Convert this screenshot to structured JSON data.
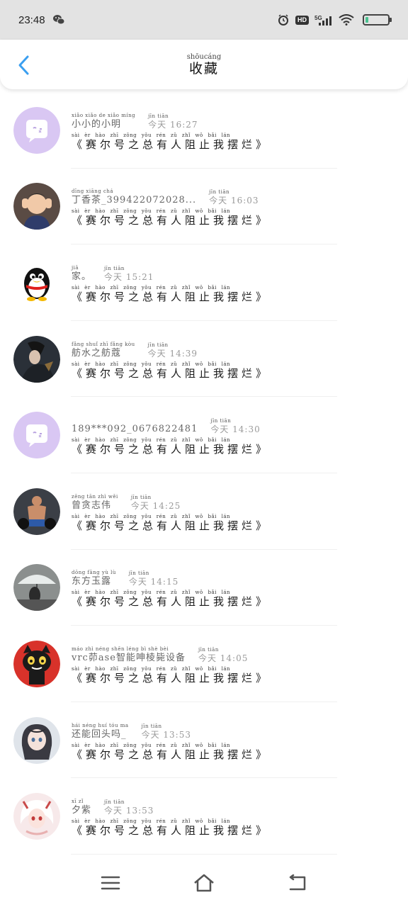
{
  "status_bar": {
    "time": "23:48",
    "app_icon": "wechat-icon",
    "icons": [
      "alarm-icon",
      "hd-badge",
      "signal-5g-icon",
      "wifi-icon",
      "battery-icon"
    ],
    "hd_label": "HD",
    "network_label": "5G"
  },
  "header": {
    "back_icon": "chevron-left-icon",
    "title_pinyin": "shōucáng",
    "title": "收藏",
    "accent_color": "#3a9ff0"
  },
  "items": [
    {
      "name_pinyin": "xiǎo xiǎo  de  xiǎo míng",
      "name": "小小的小明",
      "time_pinyin": "jīn tiān",
      "time": "今天 16:27",
      "title_pinyin": "sài  èr  hào  zhī zǒng yǒu rén  zǔ  zhǐ  wǒ  bǎi  lán",
      "title": "《赛尔号之总有人阻止我摆烂》",
      "avatar": "default-chat-avatar"
    },
    {
      "name_pinyin": "dīng xiāng chá",
      "name": "丁香茶_399422072028...",
      "time_pinyin": "jīn tiān",
      "time": "今天 16:03",
      "title_pinyin": "sài  èr  hào  zhī zǒng yǒu rén  zǔ  zhǐ  wǒ  bǎi  lán",
      "title": "《赛尔号之总有人阻止我摆烂》",
      "avatar": "child-photo-avatar"
    },
    {
      "name_pinyin": "jiā",
      "name": "家。",
      "time_pinyin": "jīn tiān",
      "time": "今天 15:21",
      "title_pinyin": "sài  èr  hào  zhī zǒng yǒu rén  zǔ  zhǐ  wǒ  bǎi  lán",
      "title": "《赛尔号之总有人阻止我摆烂》",
      "avatar": "penguin-avatar"
    },
    {
      "name_pinyin": "fǎng shuǐ zhī fǎng kòu",
      "name": "舫水之舫蔻",
      "time_pinyin": "jīn tiān",
      "time": "今天 14:39",
      "title_pinyin": "sài  èr  hào  zhī zǒng yǒu rén  zǔ  zhǐ  wǒ  bǎi  lán",
      "title": "《赛尔号之总有人阻止我摆烂》",
      "avatar": "game-character-avatar"
    },
    {
      "name_pinyin": "",
      "name": "189***092_0676822481",
      "time_pinyin": "jīn tiān",
      "time": "今天 14:30",
      "title_pinyin": "sài  èr  hào  zhī zǒng yǒu rén  zǔ  zhǐ  wǒ  bǎi  lán",
      "title": "《赛尔号之总有人阻止我摆烂》",
      "avatar": "default-chat-avatar"
    },
    {
      "name_pinyin": "zēng tān  zhì  wěi",
      "name": "曾贪志伟",
      "time_pinyin": "jīn tiān",
      "time": "今天 14:25",
      "title_pinyin": "sài  èr  hào  zhī zǒng yǒu rén  zǔ  zhǐ  wǒ  bǎi  lán",
      "title": "《赛尔号之总有人阻止我摆烂》",
      "avatar": "fitness-photo-avatar"
    },
    {
      "name_pinyin": "dōng fāng  yù   lù",
      "name": "东方玉露",
      "time_pinyin": "jīn tiān",
      "time": "今天 14:15",
      "title_pinyin": "sài  èr  hào  zhī zǒng yǒu rén  zǔ  zhǐ  wǒ  bǎi  lán",
      "title": "《赛尔号之总有人阻止我摆烂》",
      "avatar": "umbrella-photo-avatar"
    },
    {
      "name_pinyin": "   máo         zhì néng shēn léng  bì  shè  bèi",
      "name": "vrc茆ase智能呻棱毙设备",
      "time_pinyin": "jīn tiān",
      "time": "今天 14:05",
      "title_pinyin": "sài  èr  hào  zhī zǒng yǒu rén  zǔ  zhǐ  wǒ  bǎi  lán",
      "title": "《赛尔号之总有人阻止我摆烂》",
      "avatar": "cartoon-cat-avatar"
    },
    {
      "name_pinyin": "hái néng huí tóu  ma",
      "name": "还能回头吗_",
      "time_pinyin": "jīn tiān",
      "time": "今天 13:53",
      "title_pinyin": "sài  èr  hào  zhī zǒng yǒu rén  zǔ  zhǐ  wǒ  bǎi  lán",
      "title": "《赛尔号之总有人阻止我摆烂》",
      "avatar": "anime-girl-avatar"
    },
    {
      "name_pinyin": "xī  zǐ",
      "name": "夕紫",
      "time_pinyin": "jīn tiān",
      "time": "今天 13:53",
      "title_pinyin": "sài  èr  hào  zhī zǒng yǒu rén  zǔ  zhǐ  wǒ  bǎi  lán",
      "title": "《赛尔号之总有人阻止我摆烂》",
      "avatar": "anime-white-hair-avatar"
    }
  ],
  "nav_bar": {
    "icons": [
      "menu-icon",
      "home-icon",
      "back-icon"
    ]
  }
}
